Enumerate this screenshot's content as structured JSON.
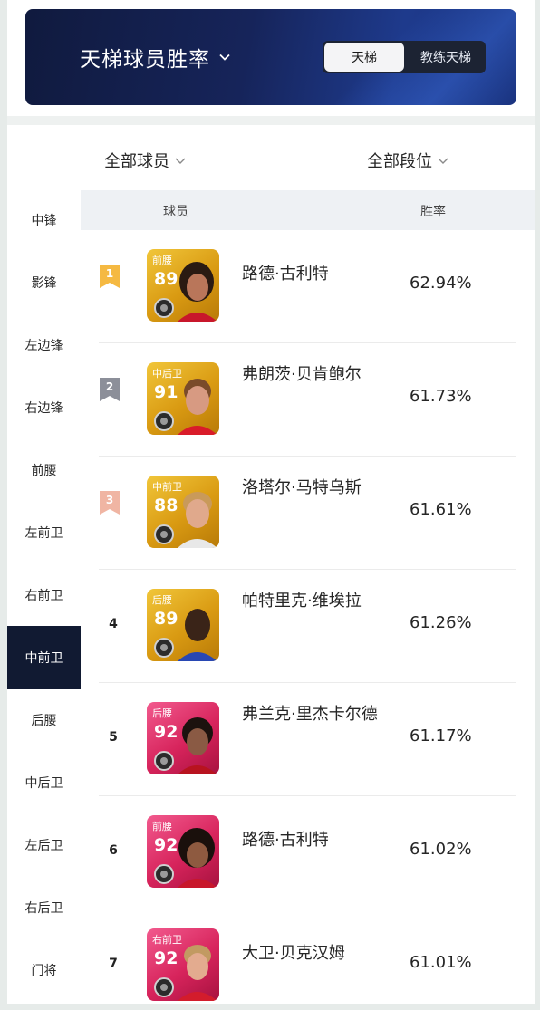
{
  "header": {
    "title": "天梯球员胜率",
    "tabs": [
      {
        "label": "天梯",
        "active": true
      },
      {
        "label": "教练天梯",
        "active": false
      }
    ]
  },
  "filters": {
    "player_filter": "全部球员",
    "rank_filter": "全部段位"
  },
  "sidebar": {
    "items": [
      {
        "label": "中锋",
        "active": false
      },
      {
        "label": "影锋",
        "active": false
      },
      {
        "label": "左边锋",
        "active": false
      },
      {
        "label": "右边锋",
        "active": false
      },
      {
        "label": "前腰",
        "active": false
      },
      {
        "label": "左前卫",
        "active": false
      },
      {
        "label": "右前卫",
        "active": false
      },
      {
        "label": "中前卫",
        "active": true
      },
      {
        "label": "后腰",
        "active": false
      },
      {
        "label": "中后卫",
        "active": false
      },
      {
        "label": "左后卫",
        "active": false
      },
      {
        "label": "右后卫",
        "active": false
      },
      {
        "label": "门将",
        "active": false
      }
    ]
  },
  "table": {
    "columns": [
      "球员",
      "胜率"
    ],
    "rows": [
      {
        "rank": "1",
        "name": "路德·古利特",
        "position": "前腰",
        "rating": "89",
        "win_rate": "62.94%",
        "card": "gold"
      },
      {
        "rank": "2",
        "name": "弗朗茨·贝肯鲍尔",
        "position": "中后卫",
        "rating": "91",
        "win_rate": "61.73%",
        "card": "gold"
      },
      {
        "rank": "3",
        "name": "洛塔尔·马特乌斯",
        "position": "中前卫",
        "rating": "88",
        "win_rate": "61.61%",
        "card": "gold"
      },
      {
        "rank": "4",
        "name": "帕特里克·维埃拉",
        "position": "后腰",
        "rating": "89",
        "win_rate": "61.26%",
        "card": "gold"
      },
      {
        "rank": "5",
        "name": "弗兰克·里杰卡尔德",
        "position": "后腰",
        "rating": "92",
        "win_rate": "61.17%",
        "card": "pink"
      },
      {
        "rank": "6",
        "name": "路德·古利特",
        "position": "前腰",
        "rating": "92",
        "win_rate": "61.02%",
        "card": "pink"
      },
      {
        "rank": "7",
        "name": "大卫·贝克汉姆",
        "position": "右前卫",
        "rating": "92",
        "win_rate": "61.01%",
        "card": "pink"
      }
    ]
  },
  "colors": {
    "banner": "#16245a",
    "sidebar_active": "#111a32",
    "gold_ribbon": "#f5b942",
    "silver_ribbon": "#8c8f99",
    "bronze_ribbon": "#f0b5a3"
  }
}
